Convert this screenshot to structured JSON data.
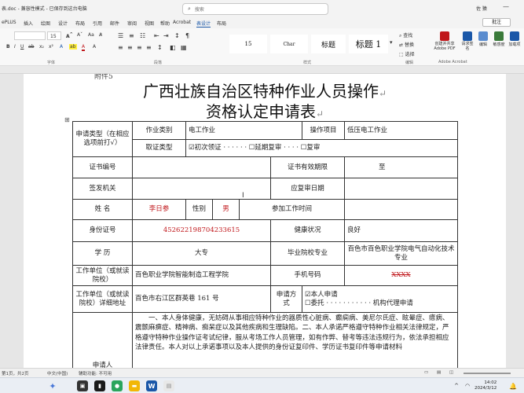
{
  "window": {
    "title": "表.doc  -  兼容性模式  -  已保存到这台电脑",
    "search_placeholder": "搜索",
    "user": "佐 猿"
  },
  "menu": {
    "items": [
      "ePLUS",
      "插入",
      "绘图",
      "设计",
      "布局",
      "引用",
      "邮件",
      "审阅",
      "视图",
      "帮助",
      "Acrobat",
      "表设计",
      "布局"
    ],
    "active": "表设计",
    "comment_button": "批注"
  },
  "ribbon": {
    "font_size_value": "15",
    "styles": [
      "15",
      "Char",
      "标题",
      "标题 1"
    ],
    "find_label": "查找",
    "replace_label": "替换",
    "select_label": "选择",
    "groups": [
      "字体",
      "段落",
      "样式",
      "编辑",
      "Adobe Acrobat"
    ],
    "adobe_buttons": [
      "创建并共享 Adobe PDF",
      "请求签名",
      "编辑"
    ],
    "extra_buttons": [
      "敏感度",
      "加载项"
    ]
  },
  "document": {
    "header_fragment": "附件5",
    "title_line1": "广西壮族自治区特种作业人员操作",
    "title_line2": "资格认定申请表",
    "form": {
      "r1": {
        "label": "申请类型（在相应选项前打√）",
        "cat_label": "作业类别",
        "cat_value": "电工作业",
        "item_label": "操作项目",
        "item_value": "低压电工作业"
      },
      "r2": {
        "label": "取证类型",
        "opt1": "☑初次领证",
        "opt2": "☐延期复审",
        "opt3": "☐复审"
      },
      "r3": {
        "label": "证书编号",
        "validity_label": "证书有效期限",
        "to": "至"
      },
      "r4": {
        "label": "签发机关",
        "review_label": "应复审日期"
      },
      "r5": {
        "name_label": "姓  名",
        "name_value": "李日参",
        "gender_label": "性别",
        "gender_value": "男",
        "work_time_label": "参加工作时间"
      },
      "r6": {
        "label": "身份证号",
        "value": "452622198704233615",
        "health_label": "健康状况",
        "health_value": "良好"
      },
      "r7": {
        "label": "学  历",
        "value": "大专",
        "school_label": "毕业院校专业",
        "school_value": "百色市百色职业学院电气自动化技术专业"
      },
      "r8": {
        "label": "工作单位（或就读院校）",
        "value": "百色职业学院智能制造工程学院",
        "phone_label": "手机号码",
        "phone_value": "XXXX"
      },
      "r9": {
        "label": "工作单位（或就读院校）详细地址",
        "value": "百色市右江区群英巷 161 号",
        "apply_label": "申请方式",
        "opt1": "☑本人申请",
        "opt2": "☐委托",
        "opt2_suffix": "机构代理申请"
      },
      "r10": {
        "label": "申请人",
        "text": "一、本人身体健康，无妨碍从事相应特种作业的器质性心脏病、癫痫病、美尼尔氏症、眩晕症、癔病、震颤麻痹症、精神病、痴呆症以及其他疾病和生理缺陷。二、本人承诺严格遵守特种作业相关法律规定，严格遵守特种作业操作证考试纪律，服从考场工作人员管理，如有作弊、替考等违法违规行为，依法承担相应法律责任。本人对以上承诺事项以及本人提供的身份证复印件、学历证书复印件等申请材料"
      }
    }
  },
  "statusbar": {
    "left": "第1页，共2页",
    "mid": "中文(中国)",
    "focus": "辅助功能: 不可用"
  },
  "taskbar": {
    "time": "14:02",
    "date": "2024/3/12"
  },
  "colors": {
    "accent": "#1a57a8",
    "form_red": "#c0171b"
  }
}
